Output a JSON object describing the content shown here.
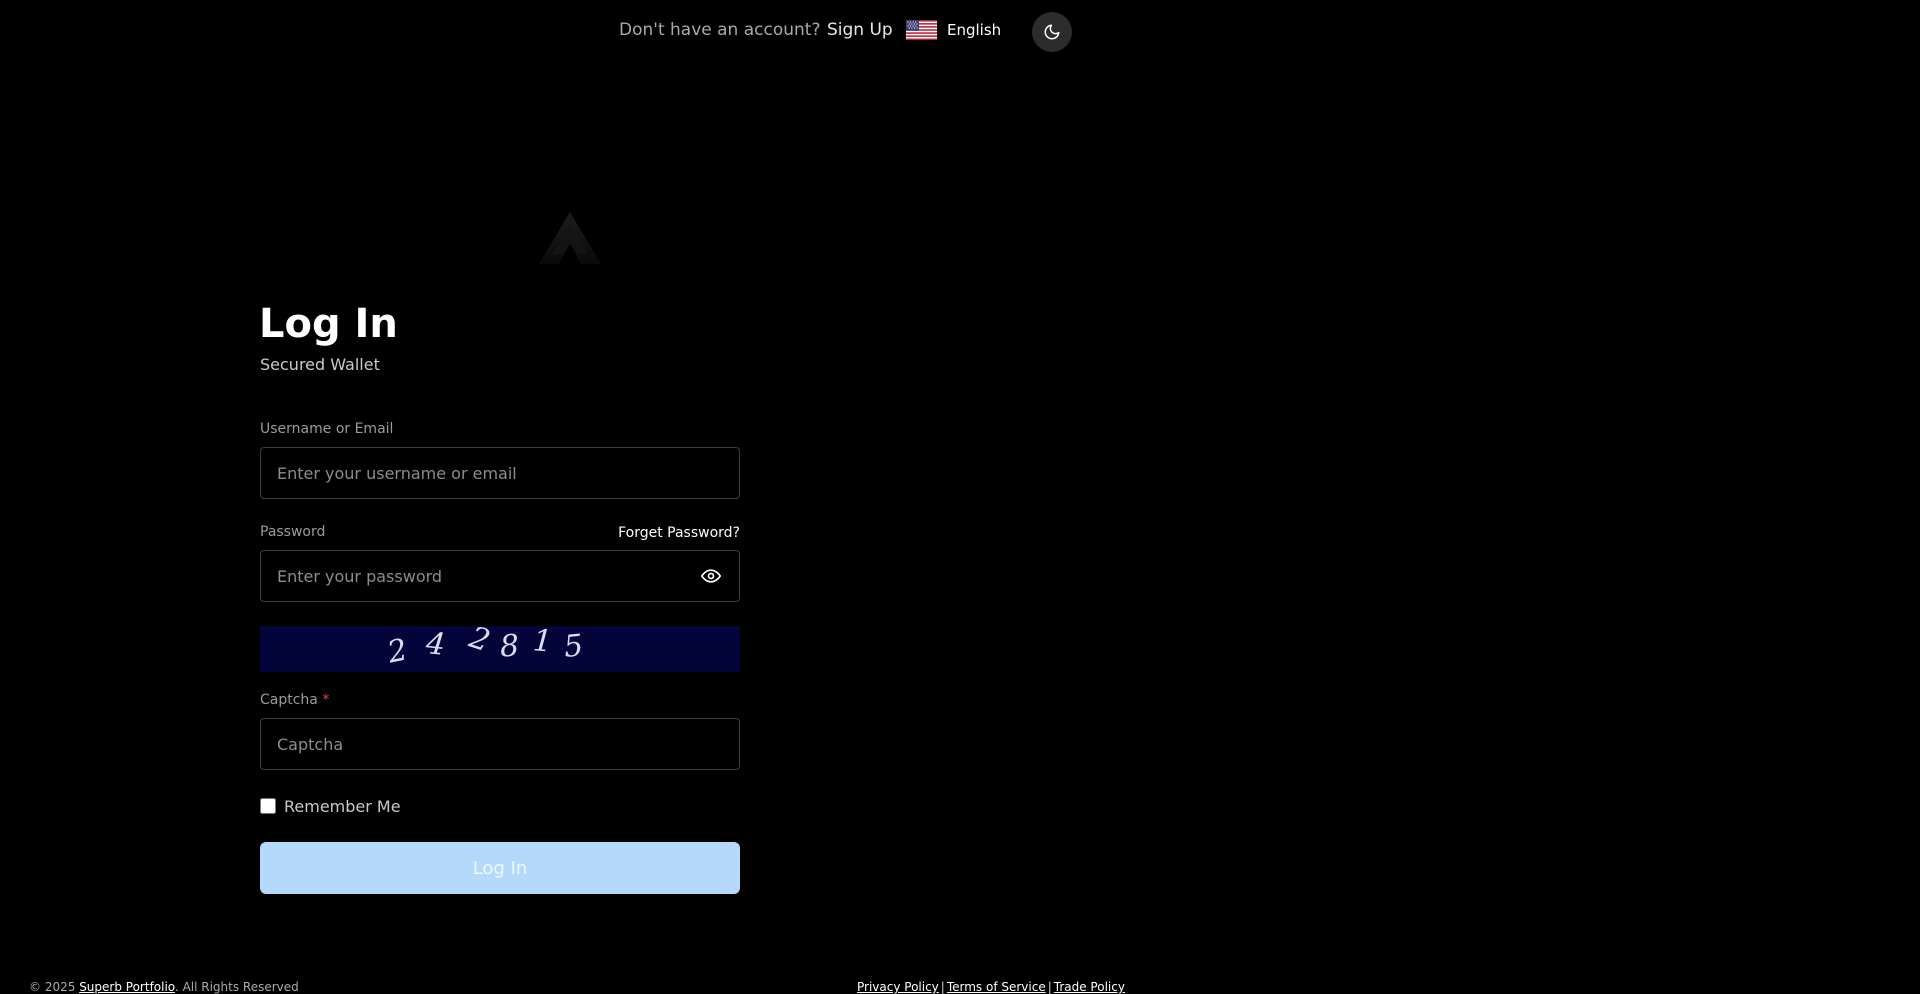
{
  "header": {
    "no_account_text": "Don't have an account?",
    "signup_label": "Sign Up",
    "language": {
      "label": "English",
      "flag_icon": "us-flag-icon"
    },
    "theme_toggle_icon": "moon-icon"
  },
  "logo": {
    "icon": "triangle-logo-icon"
  },
  "login": {
    "title": "Log In",
    "subtitle": "Secured Wallet",
    "username": {
      "label": "Username or Email",
      "placeholder": "Enter your username or email",
      "value": ""
    },
    "password": {
      "label": "Password",
      "placeholder": "Enter your password",
      "value": "",
      "toggle_icon": "eye-icon"
    },
    "forget_password_label": "Forget Password?",
    "captcha": {
      "digits": [
        "2",
        "4",
        "2",
        "8",
        "1",
        "5"
      ],
      "label": "Captcha",
      "required_marker": "*",
      "placeholder": "Captcha",
      "value": ""
    },
    "remember_me": {
      "label": "Remember Me",
      "checked": false
    },
    "submit_label": "Log In"
  },
  "footer": {
    "copyright_prefix": "© 2025",
    "brand": "Superb Portfolio",
    "copyright_suffix": ". All Rights Reserved",
    "links": [
      "Privacy Policy",
      "Terms of Service",
      "Trade Policy"
    ],
    "separator": "|"
  },
  "colors": {
    "background": "#000000",
    "button_bg": "#b5d9fb",
    "captcha_bg": "#03053a",
    "input_border": "#3f3f3f",
    "required": "#e0443c"
  }
}
